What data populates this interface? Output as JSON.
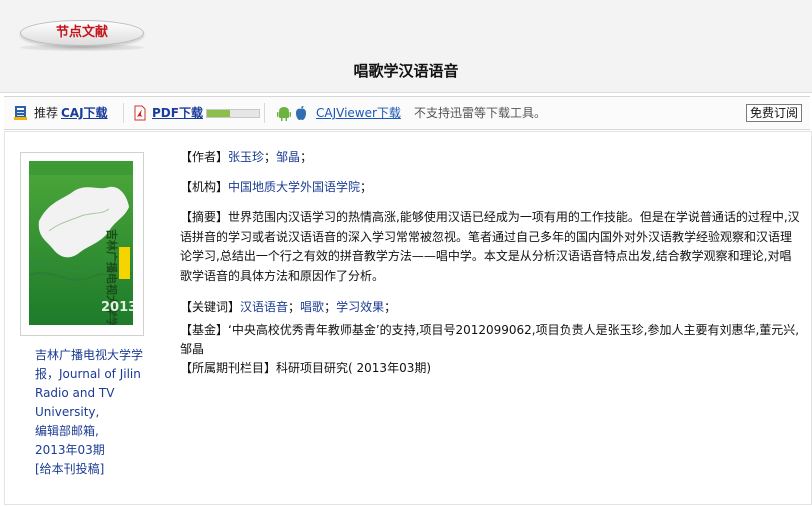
{
  "header": {
    "badge": "节点文献",
    "title": "唱歌学汉语语音"
  },
  "toolbar": {
    "caj_prefix": "推荐",
    "caj_label": "CAJ下载",
    "pdf_label": "PDF下载",
    "pdf_progress": 0.45,
    "viewer_label": "CAJViewer下载",
    "note": "不支持迅雷等下载工具。",
    "subscribe_label": "免费订阅"
  },
  "sidebar": {
    "journal_line1": "吉林广播电视大学学",
    "journal_line2": "报，Journal of Jilin",
    "journal_line3": "Radio and TV",
    "journal_line4": "University,",
    "journal_line5": "编辑部邮箱,",
    "journal_line6": "2013年03期",
    "submit": "[给本刊投稿]",
    "cover": {
      "title_text": "吉林广播电视大学学报",
      "year_text": "2013.3"
    }
  },
  "article": {
    "authors_label": "【作者】",
    "author1": "张玉珍",
    "author2": "邹晶",
    "org_label": "【机构】",
    "org": "中国地质大学外国语学院",
    "abstract_label": "【摘要】",
    "abstract": "世界范围内汉语学习的热情高涨,能够使用汉语已经成为一项有用的工作技能。但是在学说普通话的过程中,汉语拼音的学习或者说汉语语音的深入学习常常被忽视。笔者通过自己多年的国内国外对外汉语教学经验观察和汉语理论学习,总结出一个行之有效的拼音教学方法——唱中学。本文是从分析汉语语音特点出发,结合教学观察和理论,对唱歌学语音的具体方法和原因作了分析。",
    "keywords_label": "【关键词】",
    "keyword1": "汉语语音",
    "keyword2": "唱歌",
    "keyword3": "学习效果",
    "fund_label": "【基金】",
    "fund": "‘中央高校优秀青年教师基金’的支持,项目号2012099062,项目负责人是张玉珍,参加人主要有刘惠华,董元兴,邹晶",
    "column_label": "【所属期刊栏目】",
    "column": "科研项目研究",
    "issue": "( 2013年03期)"
  }
}
